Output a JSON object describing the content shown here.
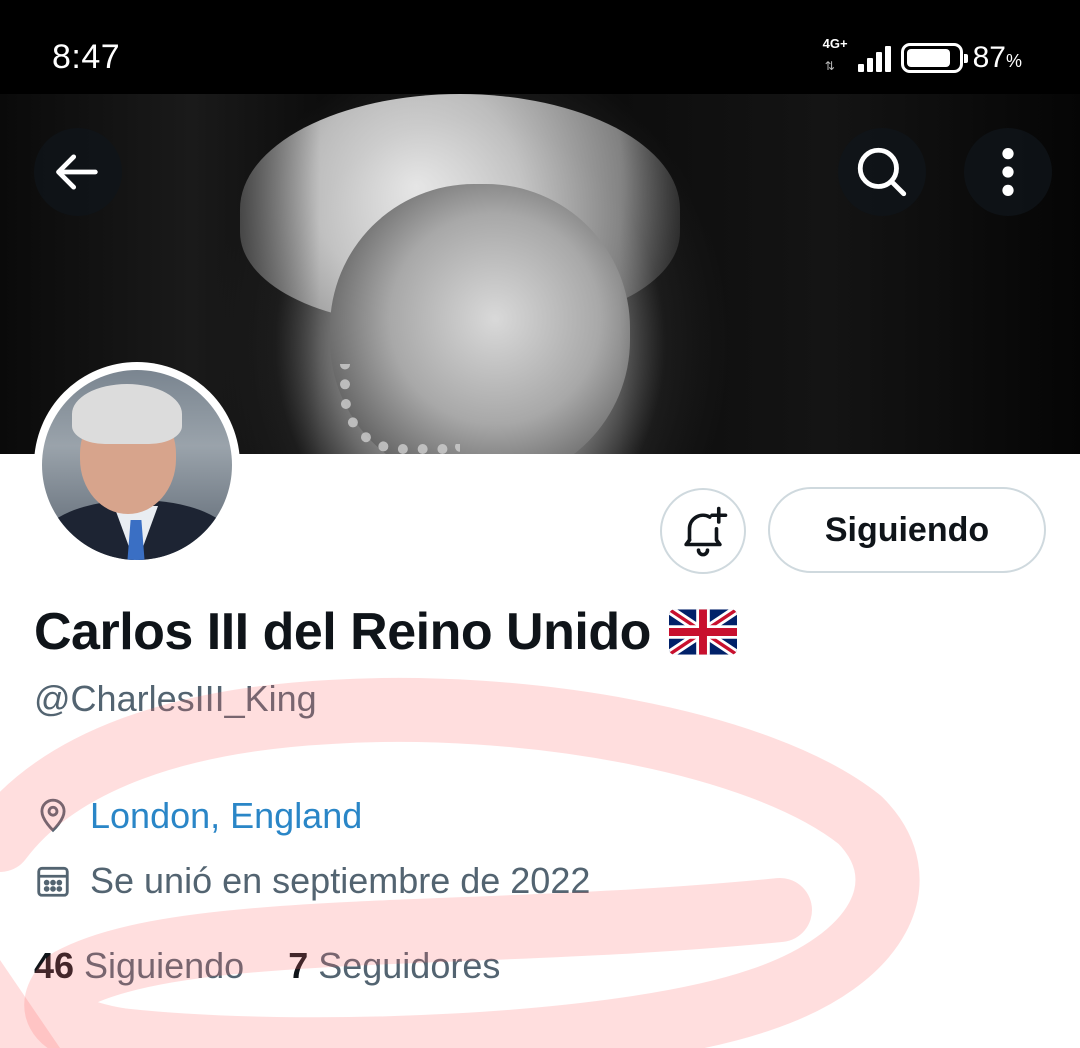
{
  "status_bar": {
    "time": "8:47",
    "network": "4G+",
    "signal_level": 0.8,
    "battery_level": 0.87,
    "battery_percent": "87",
    "battery_unit": "%"
  },
  "profile": {
    "display_name": "Carlos III del Reino Unido",
    "flag_emoji_icon": "union-jack-flag-icon",
    "handle": "@CharlesIII_King",
    "location": "London, England",
    "joined": "Se unió en septiembre de 2022",
    "following_count": "46",
    "following_label": "Siguiendo",
    "followers_count": "7",
    "followers_label": "Seguidores"
  },
  "actions": {
    "follow_button_label": "Siguiendo",
    "notifications_icon": "bell-plus-icon",
    "back_icon": "arrow-left-icon",
    "search_icon": "search-icon",
    "more_icon": "more-vertical-icon"
  },
  "colors": {
    "text_primary": "#0f1419",
    "text_secondary": "#536471",
    "link": "#2a86c7",
    "border": "#cfd9de",
    "marker": "#ff6b6b"
  }
}
